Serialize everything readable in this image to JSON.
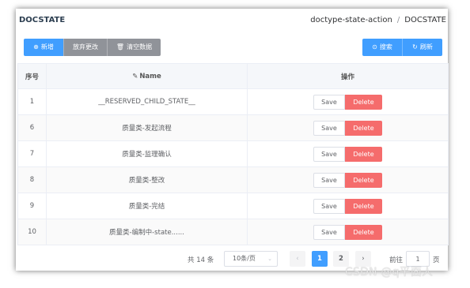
{
  "header": {
    "title": "DOCSTATE",
    "breadcrumb": [
      "doctype-state-action",
      "DOCSTATE"
    ],
    "breadcrumb_sep": "/"
  },
  "toolbar": {
    "add_label": "新增",
    "discard_label": "放弃更改",
    "clear_label": "清空数据",
    "search_label": "搜索",
    "refresh_label": "刷新"
  },
  "table": {
    "columns": [
      "序号",
      "Name",
      "操作"
    ],
    "rows": [
      {
        "idx": "1",
        "name": "__RESERVED_CHILD_STATE__"
      },
      {
        "idx": "6",
        "name": "质量类-发起流程"
      },
      {
        "idx": "7",
        "name": "质量类-监理确认"
      },
      {
        "idx": "8",
        "name": "质量类-整改"
      },
      {
        "idx": "9",
        "name": "质量类-完结"
      },
      {
        "idx": "10",
        "name": "质量类-编制中-state......"
      }
    ],
    "save_label": "Save",
    "delete_label": "Delete"
  },
  "pagination": {
    "total_text": "共 14 条",
    "page_size": "10条/页",
    "pages": [
      "1",
      "2"
    ],
    "current_page": "1",
    "goto_prefix": "前往",
    "goto_value": "1",
    "goto_suffix": "页"
  },
  "watermark": "CSDN @q平面人",
  "colors": {
    "primary": "#409eff",
    "info": "#909399",
    "danger": "#f56c6c"
  }
}
